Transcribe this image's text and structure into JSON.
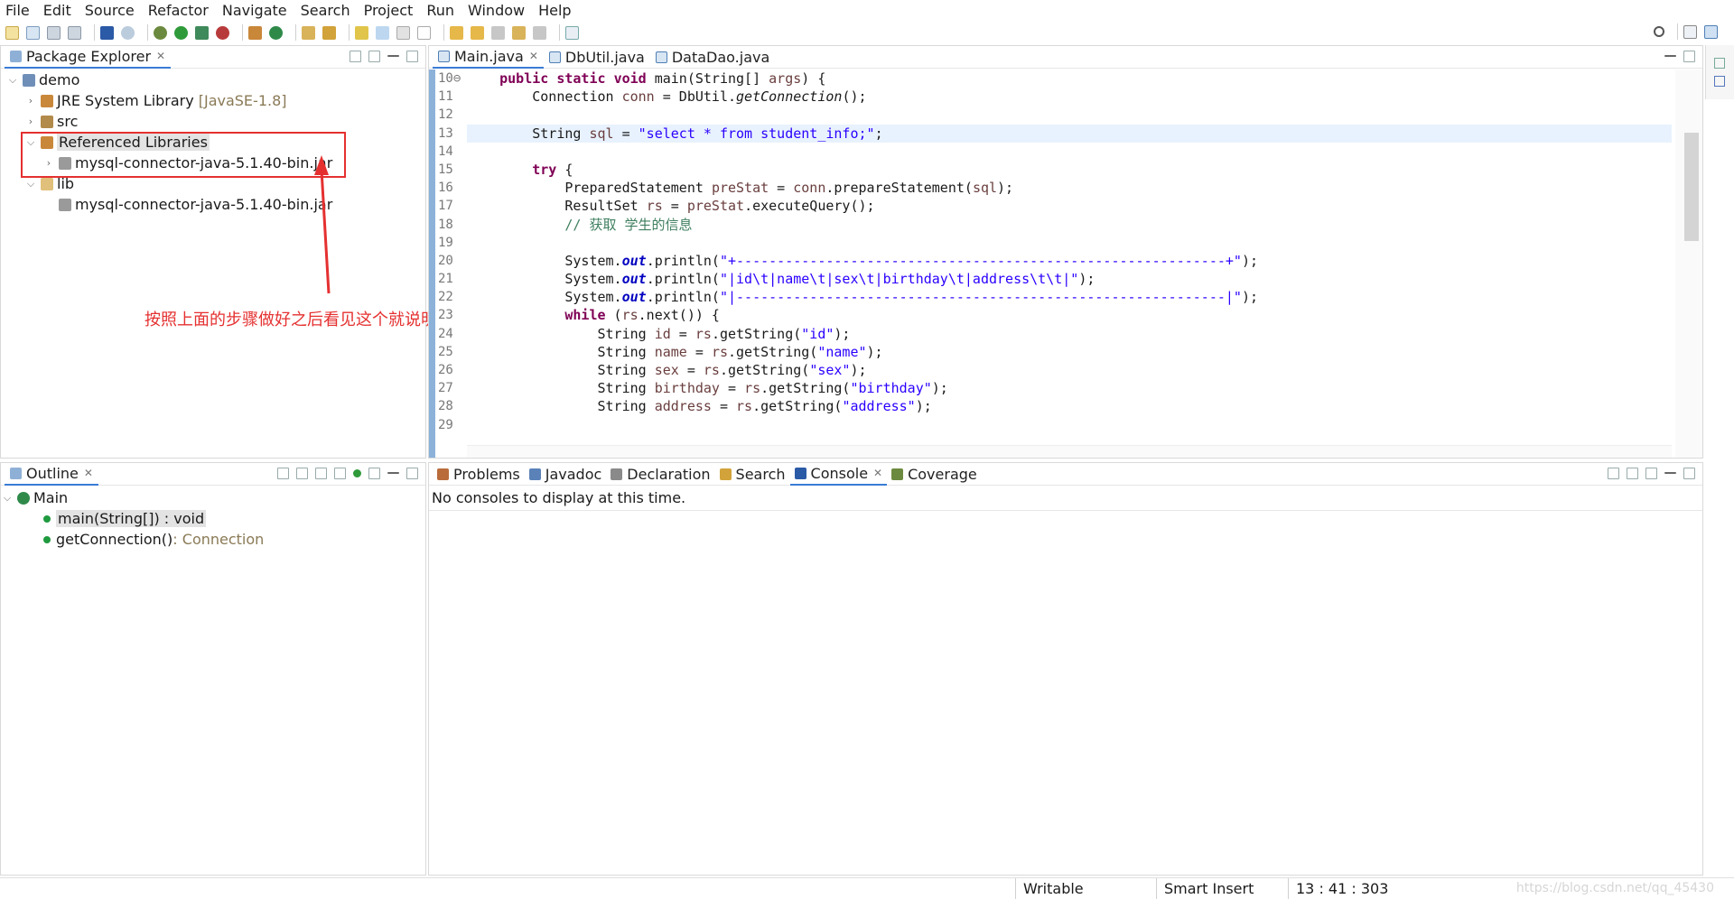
{
  "menu": [
    "File",
    "Edit",
    "Source",
    "Refactor",
    "Navigate",
    "Search",
    "Project",
    "Run",
    "Window",
    "Help"
  ],
  "package_explorer": {
    "title": "Package Explorer",
    "tree": [
      {
        "label": "demo",
        "depth": 0,
        "expanded": true
      },
      {
        "label": "JRE System Library",
        "suffix": "[JavaSE-1.8]",
        "depth": 1,
        "expanded": false
      },
      {
        "label": "src",
        "depth": 1,
        "expanded": false
      },
      {
        "label": "Referenced Libraries",
        "depth": 1,
        "expanded": true,
        "selected": true
      },
      {
        "label": "mysql-connector-java-5.1.40-bin.jar",
        "depth": 2,
        "expanded": false
      },
      {
        "label": "lib",
        "depth": 1,
        "expanded": true
      },
      {
        "label": "mysql-connector-java-5.1.40-bin.jar",
        "depth": 2
      }
    ]
  },
  "annotation": {
    "text": "按照上面的步骤做好之后看见这个就说明操作对了"
  },
  "editor": {
    "tabs": [
      "Main.java",
      "DbUtil.java",
      "DataDao.java"
    ],
    "active_tab": "Main.java",
    "lines": [
      {
        "num": "10⊖",
        "code": "    public static void main(String[] args) {"
      },
      {
        "num": "11",
        "code": "        Connection conn = DbUtil.getConnection();"
      },
      {
        "num": "12",
        "code": ""
      },
      {
        "num": "13",
        "code": "        String sql = \"select * from student_info;\";"
      },
      {
        "num": "14",
        "code": ""
      },
      {
        "num": "15",
        "code": "        try {"
      },
      {
        "num": "16",
        "code": "            PreparedStatement preStat = conn.prepareStatement(sql);"
      },
      {
        "num": "17",
        "code": "            ResultSet rs = preStat.executeQuery();"
      },
      {
        "num": "18",
        "code": "            // 获取 学生的信息"
      },
      {
        "num": "19",
        "code": ""
      },
      {
        "num": "20",
        "code": "            System.out.println(\"+------------------------------------------------------------+\");"
      },
      {
        "num": "21",
        "code": "            System.out.println(\"|id\\t|name\\t|sex\\t|birthday\\t|address\\t\\t|\");"
      },
      {
        "num": "22",
        "code": "            System.out.println(\"|------------------------------------------------------------|\");"
      },
      {
        "num": "23",
        "code": "            while (rs.next()) {"
      },
      {
        "num": "24",
        "code": "                String id = rs.getString(\"id\");"
      },
      {
        "num": "25",
        "code": "                String name = rs.getString(\"name\");"
      },
      {
        "num": "26",
        "code": "                String sex = rs.getString(\"sex\");"
      },
      {
        "num": "27",
        "code": "                String birthday = rs.getString(\"birthday\");"
      },
      {
        "num": "28",
        "code": "                String address = rs.getString(\"address\");"
      },
      {
        "num": "29",
        "code": ""
      }
    ]
  },
  "outline": {
    "title": "Outline",
    "root": "Main",
    "items": [
      {
        "label": "main(String[]) : void",
        "selected": true
      },
      {
        "label": "getConnection()",
        "type": " : Connection"
      }
    ]
  },
  "console": {
    "tabs": [
      "Problems",
      "Javadoc",
      "Declaration",
      "Search",
      "Console",
      "Coverage"
    ],
    "active_tab": "Console",
    "message": "No consoles to display at this time."
  },
  "status": {
    "writable": "Writable",
    "insert_mode": "Smart Insert",
    "position": "13 : 41 : 303",
    "watermark": "https://blog.csdn.net/qq_45430"
  }
}
